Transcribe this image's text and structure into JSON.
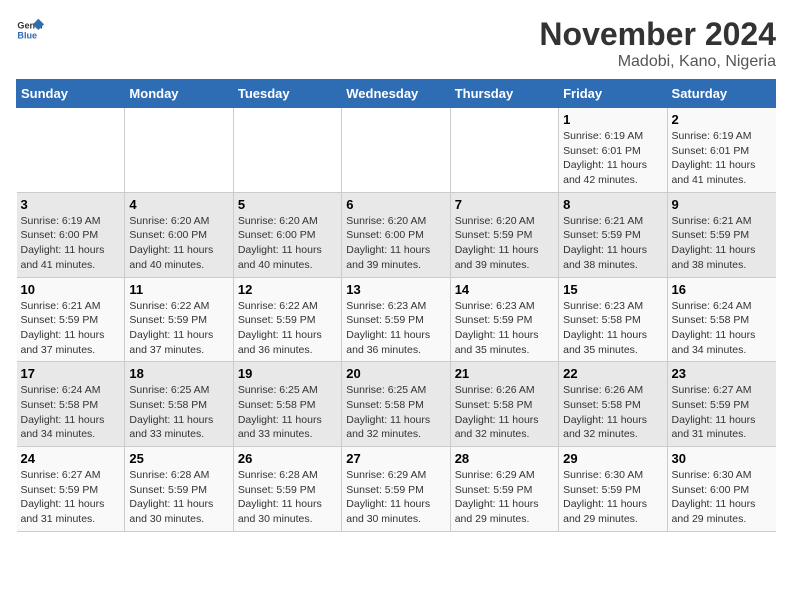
{
  "header": {
    "logo_general": "General",
    "logo_blue": "Blue",
    "title": "November 2024",
    "subtitle": "Madobi, Kano, Nigeria"
  },
  "calendar": {
    "days_of_week": [
      "Sunday",
      "Monday",
      "Tuesday",
      "Wednesday",
      "Thursday",
      "Friday",
      "Saturday"
    ],
    "weeks": [
      [
        {
          "day": "",
          "info": ""
        },
        {
          "day": "",
          "info": ""
        },
        {
          "day": "",
          "info": ""
        },
        {
          "day": "",
          "info": ""
        },
        {
          "day": "",
          "info": ""
        },
        {
          "day": "1",
          "info": "Sunrise: 6:19 AM\nSunset: 6:01 PM\nDaylight: 11 hours\nand 42 minutes."
        },
        {
          "day": "2",
          "info": "Sunrise: 6:19 AM\nSunset: 6:01 PM\nDaylight: 11 hours\nand 41 minutes."
        }
      ],
      [
        {
          "day": "3",
          "info": "Sunrise: 6:19 AM\nSunset: 6:00 PM\nDaylight: 11 hours\nand 41 minutes."
        },
        {
          "day": "4",
          "info": "Sunrise: 6:20 AM\nSunset: 6:00 PM\nDaylight: 11 hours\nand 40 minutes."
        },
        {
          "day": "5",
          "info": "Sunrise: 6:20 AM\nSunset: 6:00 PM\nDaylight: 11 hours\nand 40 minutes."
        },
        {
          "day": "6",
          "info": "Sunrise: 6:20 AM\nSunset: 6:00 PM\nDaylight: 11 hours\nand 39 minutes."
        },
        {
          "day": "7",
          "info": "Sunrise: 6:20 AM\nSunset: 5:59 PM\nDaylight: 11 hours\nand 39 minutes."
        },
        {
          "day": "8",
          "info": "Sunrise: 6:21 AM\nSunset: 5:59 PM\nDaylight: 11 hours\nand 38 minutes."
        },
        {
          "day": "9",
          "info": "Sunrise: 6:21 AM\nSunset: 5:59 PM\nDaylight: 11 hours\nand 38 minutes."
        }
      ],
      [
        {
          "day": "10",
          "info": "Sunrise: 6:21 AM\nSunset: 5:59 PM\nDaylight: 11 hours\nand 37 minutes."
        },
        {
          "day": "11",
          "info": "Sunrise: 6:22 AM\nSunset: 5:59 PM\nDaylight: 11 hours\nand 37 minutes."
        },
        {
          "day": "12",
          "info": "Sunrise: 6:22 AM\nSunset: 5:59 PM\nDaylight: 11 hours\nand 36 minutes."
        },
        {
          "day": "13",
          "info": "Sunrise: 6:23 AM\nSunset: 5:59 PM\nDaylight: 11 hours\nand 36 minutes."
        },
        {
          "day": "14",
          "info": "Sunrise: 6:23 AM\nSunset: 5:59 PM\nDaylight: 11 hours\nand 35 minutes."
        },
        {
          "day": "15",
          "info": "Sunrise: 6:23 AM\nSunset: 5:58 PM\nDaylight: 11 hours\nand 35 minutes."
        },
        {
          "day": "16",
          "info": "Sunrise: 6:24 AM\nSunset: 5:58 PM\nDaylight: 11 hours\nand 34 minutes."
        }
      ],
      [
        {
          "day": "17",
          "info": "Sunrise: 6:24 AM\nSunset: 5:58 PM\nDaylight: 11 hours\nand 34 minutes."
        },
        {
          "day": "18",
          "info": "Sunrise: 6:25 AM\nSunset: 5:58 PM\nDaylight: 11 hours\nand 33 minutes."
        },
        {
          "day": "19",
          "info": "Sunrise: 6:25 AM\nSunset: 5:58 PM\nDaylight: 11 hours\nand 33 minutes."
        },
        {
          "day": "20",
          "info": "Sunrise: 6:25 AM\nSunset: 5:58 PM\nDaylight: 11 hours\nand 32 minutes."
        },
        {
          "day": "21",
          "info": "Sunrise: 6:26 AM\nSunset: 5:58 PM\nDaylight: 11 hours\nand 32 minutes."
        },
        {
          "day": "22",
          "info": "Sunrise: 6:26 AM\nSunset: 5:58 PM\nDaylight: 11 hours\nand 32 minutes."
        },
        {
          "day": "23",
          "info": "Sunrise: 6:27 AM\nSunset: 5:59 PM\nDaylight: 11 hours\nand 31 minutes."
        }
      ],
      [
        {
          "day": "24",
          "info": "Sunrise: 6:27 AM\nSunset: 5:59 PM\nDaylight: 11 hours\nand 31 minutes."
        },
        {
          "day": "25",
          "info": "Sunrise: 6:28 AM\nSunset: 5:59 PM\nDaylight: 11 hours\nand 30 minutes."
        },
        {
          "day": "26",
          "info": "Sunrise: 6:28 AM\nSunset: 5:59 PM\nDaylight: 11 hours\nand 30 minutes."
        },
        {
          "day": "27",
          "info": "Sunrise: 6:29 AM\nSunset: 5:59 PM\nDaylight: 11 hours\nand 30 minutes."
        },
        {
          "day": "28",
          "info": "Sunrise: 6:29 AM\nSunset: 5:59 PM\nDaylight: 11 hours\nand 29 minutes."
        },
        {
          "day": "29",
          "info": "Sunrise: 6:30 AM\nSunset: 5:59 PM\nDaylight: 11 hours\nand 29 minutes."
        },
        {
          "day": "30",
          "info": "Sunrise: 6:30 AM\nSunset: 6:00 PM\nDaylight: 11 hours\nand 29 minutes."
        }
      ]
    ]
  }
}
